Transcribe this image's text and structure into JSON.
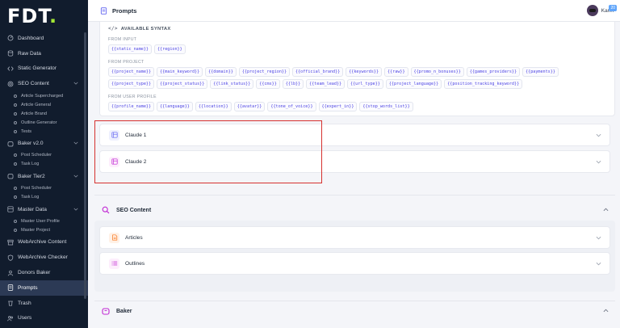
{
  "app": {
    "logo_text": "FDT",
    "logo_dot": "."
  },
  "sidebar": {
    "items": [
      {
        "label": "Dashboard",
        "icon": "dashboard-icon"
      },
      {
        "label": "Raw Data",
        "icon": "database-icon"
      },
      {
        "label": "Static Generator",
        "icon": "code-icon"
      },
      {
        "label": "SEO Content",
        "icon": "target-icon",
        "expanded": true,
        "children": [
          "Article Supercharged",
          "Article General",
          "Article Brand",
          "Outline Generator",
          "Tests"
        ]
      },
      {
        "label": "Baker v2.0",
        "icon": "bread-icon",
        "expanded": true,
        "children": [
          "Post Scheduler",
          "Task Log"
        ]
      },
      {
        "label": "Baker Tier2",
        "icon": "bread-icon",
        "expanded": true,
        "children": [
          "Post Scheduler",
          "Task Log"
        ]
      },
      {
        "label": "Master Data",
        "icon": "master-data-icon",
        "expanded": true,
        "children": [
          "Master User Profile",
          "Master Project"
        ]
      },
      {
        "label": "WebArchive Content",
        "icon": "archive-icon"
      },
      {
        "label": "WebArchive Checker",
        "icon": "shield-icon"
      },
      {
        "label": "Donors Baker",
        "icon": "donors-icon"
      },
      {
        "label": "Prompts",
        "icon": "prompts-icon",
        "active": true
      },
      {
        "label": "Trash",
        "icon": "trash-icon"
      },
      {
        "label": "Users",
        "icon": "users-icon"
      }
    ]
  },
  "header": {
    "title": "Prompts",
    "user_name": "Karin",
    "badge": "20"
  },
  "syntax": {
    "title": "AVAILABLE SYNTAX",
    "icon": "code-icon",
    "groups": [
      {
        "label": "FROM INPUT",
        "tags": [
          "{{static_name}}",
          "{{region}}"
        ]
      },
      {
        "label": "FROM PROJECT",
        "tags": [
          "{{project_name}}",
          "{{main_keyword}}",
          "{{domain}}",
          "{{project_region}}",
          "{{official_brand}}",
          "{{keywords}}",
          "{{raw}}",
          "{{promo_n_bonuses}}",
          "{{games_providers}}",
          "{{payments}}",
          "{{project_type}}",
          "{{project_status}}",
          "{{link_status}}",
          "{{cms}}",
          "{{lb}}",
          "{{team_lead}}",
          "{{url_type}}",
          "{{project_language}}",
          "{{position_tracking_keyword}}"
        ]
      },
      {
        "label": "FROM USER PROFILE",
        "tags": [
          "{{profile_name}}",
          "{{language}}",
          "{{location}}",
          "{{avatar}}",
          "{{tone_of_voice}}",
          "{{expert_in}}",
          "{{stop_words_list}}"
        ]
      }
    ]
  },
  "prompt_cards": [
    {
      "label": "Claude 1",
      "icon": "claude-icon"
    },
    {
      "label": "Claude 2",
      "icon": "claude-icon"
    }
  ],
  "sections": [
    {
      "label": "SEO Content",
      "icon": "search-icon",
      "cards": [
        {
          "label": "Articles",
          "icon": "document-icon"
        },
        {
          "label": "Outlines",
          "icon": "list-icon"
        }
      ]
    },
    {
      "label": "Baker",
      "icon": "bread-icon"
    }
  ],
  "colors": {
    "sidebar_bg": "#111c2d",
    "accent": "#4f46e5",
    "logo_dot": "#a3e635",
    "highlight": "#d6312f"
  }
}
